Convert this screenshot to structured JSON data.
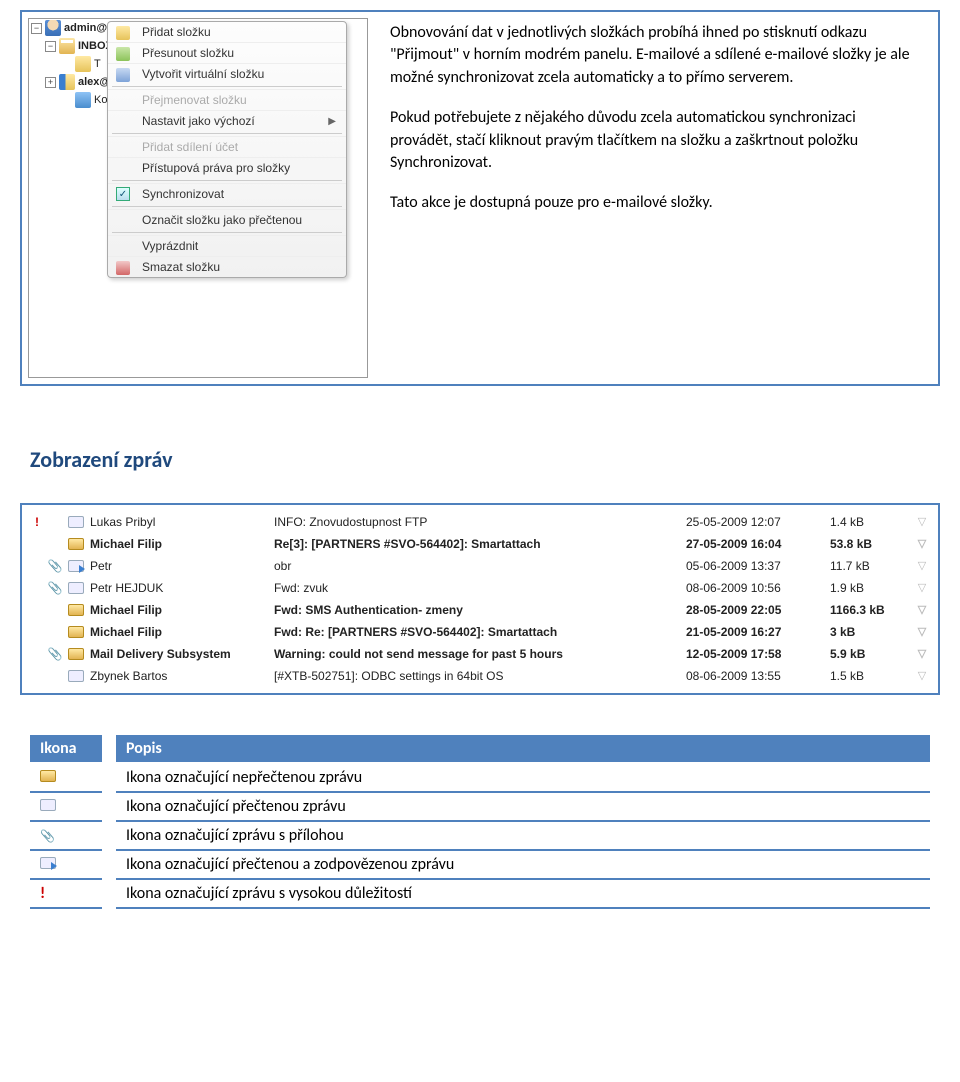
{
  "tree": {
    "root": "admin@icewarp.cz",
    "inbox": "INBOX",
    "t": "T",
    "sub": "alex@ic",
    "kont": "Kont"
  },
  "context_menu": {
    "new_folder": "Přidat složku",
    "move_folder": "Přesunout složku",
    "virtual_folder": "Vytvořit virtuální složku",
    "rename": "Přejmenovat složku",
    "set_default": "Nastavit jako výchozí",
    "add_share_account": "Přidat sdílení účet",
    "access_rights": "Přístupová práva pro složky",
    "synchronize": "Synchronizovat",
    "mark_read": "Označit složku jako přečtenou",
    "empty": "Vyprázdnit",
    "delete": "Smazat složku"
  },
  "description": {
    "p1": "Obnovování dat v jednotlivých složkách probíhá ihned po stisknutí odkazu \"Přijmout\" v horním modrém panelu. E-mailové a sdílené e-mailové složky je ale možné synchronizovat zcela automaticky a to přímo serverem.",
    "p2": "Pokud potřebujete z nějakého důvodu zcela automatickou synchronizaci provádět, stačí kliknout pravým tlačítkem na složku a zaškrtnout položku Synchronizovat.",
    "p3": "Tato akce je dostupná pouze pro e-mailové složky."
  },
  "heading": "Zobrazení zpráv",
  "messages": [
    {
      "flag": "!",
      "att": "",
      "env": "read",
      "from": "Lukas Pribyl",
      "subj": "INFO: Znovudostupnost FTP",
      "date": "25-05-2009 12:07",
      "size": "1.4 kB",
      "bold": false
    },
    {
      "flag": "",
      "att": "",
      "env": "unread",
      "from": "Michael Filip",
      "subj": "Re[3]: [PARTNERS #SVO-564402]: Smartattach",
      "date": "27-05-2009 16:04",
      "size": "53.8 kB",
      "bold": true
    },
    {
      "flag": "",
      "att": "📎",
      "env": "reply",
      "from": "Petr",
      "subj": "obr",
      "date": "05-06-2009 13:37",
      "size": "11.7 kB",
      "bold": false
    },
    {
      "flag": "",
      "att": "📎",
      "env": "read",
      "from": "Petr HEJDUK",
      "subj": "Fwd: zvuk",
      "date": "08-06-2009 10:56",
      "size": "1.9 kB",
      "bold": false
    },
    {
      "flag": "",
      "att": "",
      "env": "unread",
      "from": "Michael Filip",
      "subj": "Fwd: SMS Authentication- zmeny",
      "date": "28-05-2009 22:05",
      "size": "1166.3 kB",
      "bold": true
    },
    {
      "flag": "",
      "att": "",
      "env": "unread",
      "from": "Michael Filip",
      "subj": "Fwd: Re: [PARTNERS #SVO-564402]: Smartattach",
      "date": "21-05-2009 16:27",
      "size": "3 kB",
      "bold": true
    },
    {
      "flag": "",
      "att": "📎",
      "env": "unread",
      "from": "Mail Delivery Subsystem",
      "subj": "Warning: could not send message for past 5 hours",
      "date": "12-05-2009 17:58",
      "size": "5.9 kB",
      "bold": true
    },
    {
      "flag": "",
      "att": "",
      "env": "read",
      "from": "Zbynek Bartos",
      "subj": "[#XTB-502751]: ODBC settings in 64bit OS",
      "date": "08-06-2009 13:55",
      "size": "1.5 kB",
      "bold": false
    }
  ],
  "icon_table": {
    "header_icon": "Ikona",
    "header_desc": "Popis",
    "rows": [
      {
        "icon": "unread",
        "desc": "Ikona označující nepřečtenou zprávu"
      },
      {
        "icon": "read",
        "desc": "Ikona označující přečtenou zprávu"
      },
      {
        "icon": "clip",
        "desc": "Ikona označující zprávu s přílohou"
      },
      {
        "icon": "reply",
        "desc": "Ikona označující přečtenou  a zodpovězenou zprávu"
      },
      {
        "icon": "high",
        "desc": "Ikona označující zprávu s vysokou důležitostí"
      }
    ]
  }
}
